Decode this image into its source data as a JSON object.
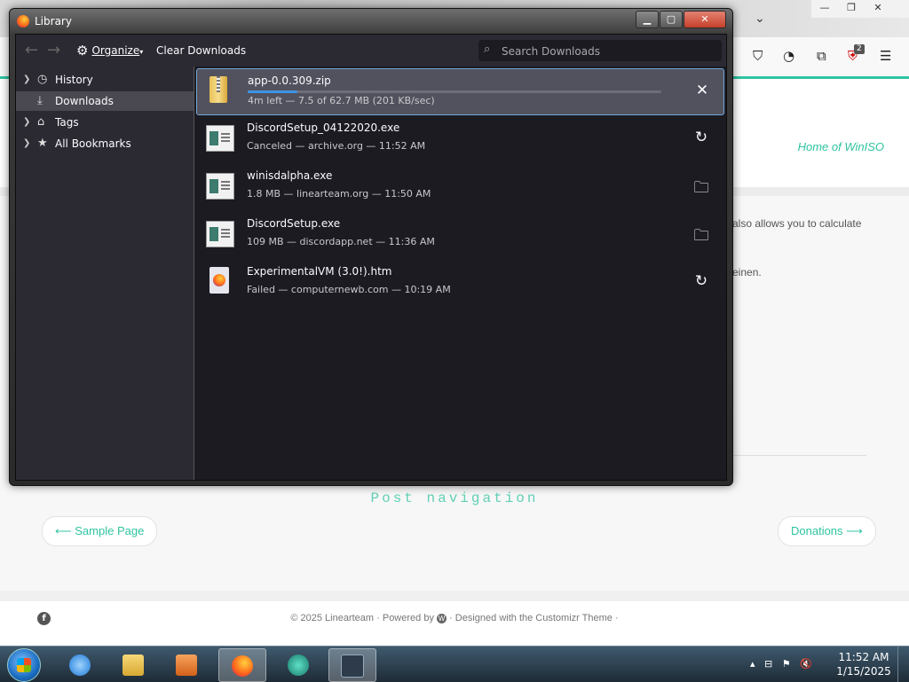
{
  "background_page": {
    "tagline": "Home of WinISO",
    "body_text_1": "also allows you to calculate",
    "body_text_2": "einen.",
    "post_navigation": "Post navigation",
    "prev_link": "⟵ Sample Page",
    "next_link": "Donations ⟶",
    "footer": "© 2025 Linearteam · Powered by",
    "footer_end": "· Designed with the Customizr Theme ·",
    "extension_badge": "2"
  },
  "library": {
    "title": "Library",
    "toolbar": {
      "organize_label": "Organize",
      "clear_label": "Clear Downloads",
      "search_placeholder": "Search Downloads"
    },
    "sidebar": {
      "items": [
        {
          "label": "History",
          "icon": "clock-icon"
        },
        {
          "label": "Downloads",
          "icon": "download-icon",
          "selected": true
        },
        {
          "label": "Tags",
          "icon": "tag-icon"
        },
        {
          "label": "All Bookmarks",
          "icon": "star-icon"
        }
      ]
    },
    "downloads": [
      {
        "name": "app-0.0.309.zip",
        "meta": "4m left — 7.5 of 62.7 MB (201 KB/sec)",
        "progress": 0.12,
        "action": "cancel"
      },
      {
        "name": "DiscordSetup_04122020.exe",
        "meta": "Canceled — archive.org — 11:52 AM",
        "action": "retry"
      },
      {
        "name": "winisdalpha.exe",
        "meta": "1.8 MB — linearteam.org — 11:50 AM",
        "action": "open-folder"
      },
      {
        "name": "DiscordSetup.exe",
        "meta": "109 MB — discordapp.net — 11:36 AM",
        "action": "open-folder"
      },
      {
        "name": "ExperimentalVM (3.0!).htm",
        "meta": "Failed — computernewb.com — 10:19 AM",
        "action": "retry"
      }
    ]
  },
  "taskbar": {
    "time": "11:52 AM",
    "date": "1/15/2025"
  },
  "colors": {
    "accent": "#2fc4a1",
    "progress": "#3d95e6",
    "selection_border": "#73a7d9"
  }
}
